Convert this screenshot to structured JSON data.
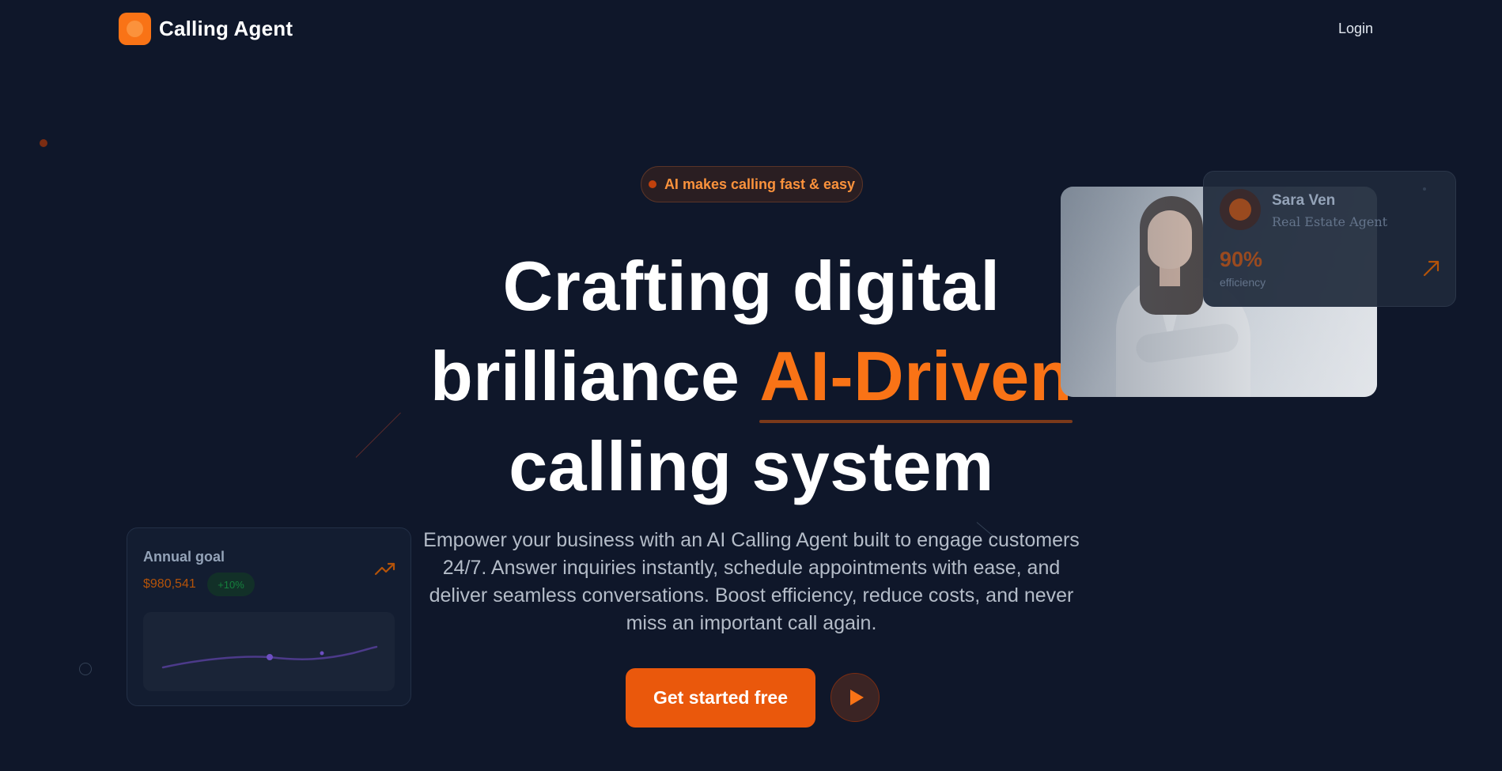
{
  "nav": {
    "brand": "Calling Agent",
    "login_label": "Login"
  },
  "hero": {
    "badge": "AI makes calling fast & easy",
    "headline_line1": "Crafting digital",
    "headline_line2_start": "brilliance",
    "headline_accent": "AI-Driven",
    "headline_line3": "calling system",
    "description": "Empower your business with an AI Calling Agent built to engage customers 24/7. Answer inquiries instantly, schedule appointments with ease, and deliver seamless conversations. Boost efficiency, reduce costs, and never miss an important call again.",
    "cta_label": "Get started free"
  },
  "profile_card": {
    "name": "Sara Ven",
    "role": "Real Estate Agent",
    "metric_value": "90%",
    "metric_label": "efficiency"
  },
  "goal_card": {
    "title": "Annual goal",
    "amount": "$980,541",
    "change": "+10%"
  },
  "colors": {
    "background": "#0f172a",
    "accent": "#f97316",
    "cta": "#ea580c",
    "positive": "#15803d"
  },
  "icons": {
    "logo": "logo-mark-icon",
    "play": "play-icon",
    "trend": "trend-up-icon",
    "arrow": "arrow-up-right-icon"
  }
}
